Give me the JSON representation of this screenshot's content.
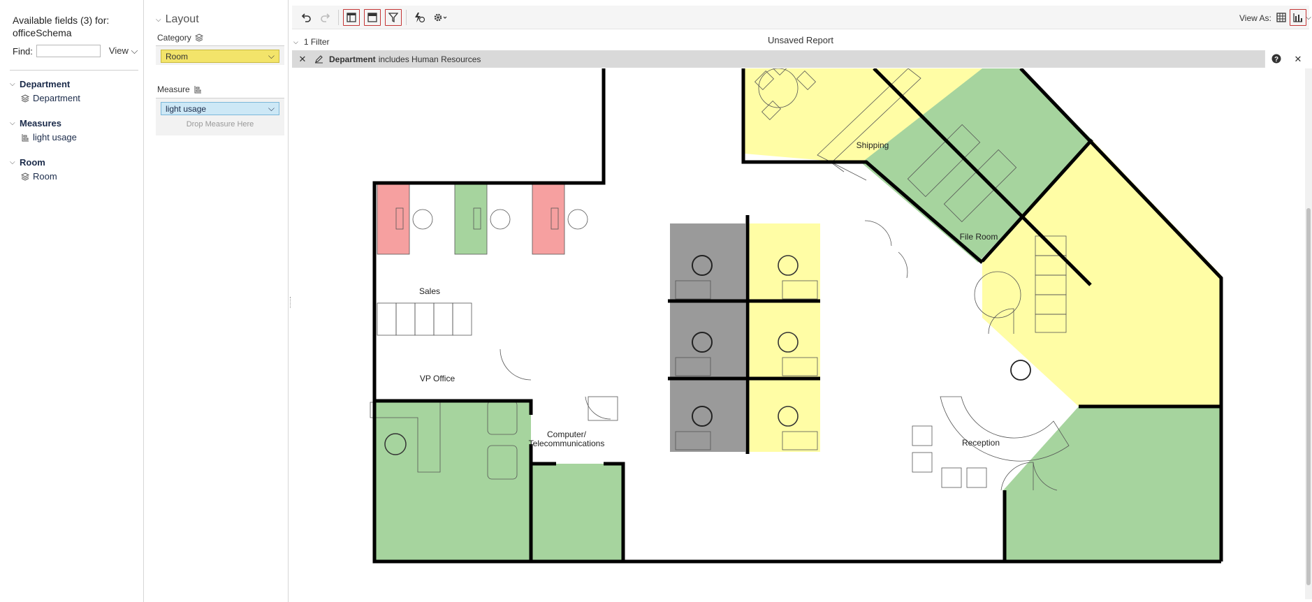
{
  "fields": {
    "title": "Available fields (3) for: officeSchema",
    "find_label": "Find:",
    "find_value": "",
    "view_label": "View",
    "groups": [
      {
        "name": "Department",
        "items": [
          "Department"
        ]
      },
      {
        "name": "Measures",
        "items": [
          "light usage"
        ]
      },
      {
        "name": "Room",
        "items": [
          "Room"
        ]
      }
    ]
  },
  "layout": {
    "title": "Layout",
    "category_label": "Category",
    "category_value": "Room",
    "measure_label": "Measure",
    "measure_value": "light usage",
    "drop_hint": "Drop Measure Here"
  },
  "toolbar": {
    "view_as_label": "View As:",
    "icons": [
      "undo-icon",
      "redo-icon",
      "switch-layout-icon",
      "table-layout-icon",
      "filter-icon",
      "auto-refresh-icon",
      "settings-icon",
      "table-view-icon",
      "chart-view-icon"
    ]
  },
  "report": {
    "title": "Unsaved Report",
    "filter_count": "1 Filter",
    "filter_field": "Department",
    "filter_text": "includes Human Resources"
  },
  "floorplan": {
    "room_labels": {
      "shipping": "Shipping",
      "file_room": "File Room",
      "sales": "Sales",
      "vp_office": "VP Office",
      "computer_1": "Computer/",
      "computer_2": "Telecommunications",
      "reception": "Reception"
    },
    "colors": {
      "green": "#a6d49e",
      "yellow": "#fffda5",
      "red": "#f6a0a0",
      "gray": "#9a9a9a",
      "wall": "#000000"
    }
  }
}
